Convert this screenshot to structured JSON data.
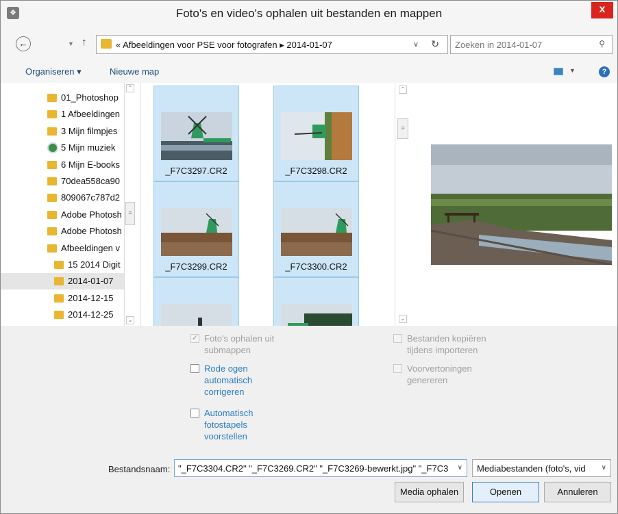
{
  "window": {
    "title": "Foto's en video's ophalen uit bestanden en mappen",
    "close_label": "x",
    "app_icon": "photoshop-elements-icon"
  },
  "address": {
    "path_prefix": "«",
    "path": "Afbeeldingen voor PSE voor fotografen  ▸  2014-01-07",
    "search_placeholder": "Zoeken in 2014-01-07"
  },
  "toolbar": {
    "organize": "Organiseren ▾",
    "new_folder": "Nieuwe map",
    "help": "?"
  },
  "nav": {
    "items": [
      {
        "label": "01_Photoshop",
        "icon": "folder-icon",
        "indent": false
      },
      {
        "label": "1 Afbeeldingen",
        "icon": "folder-icon",
        "indent": false
      },
      {
        "label": "3 Mijn filmpjes",
        "icon": "folder-icon",
        "indent": false
      },
      {
        "label": "5 Mijn muziek",
        "icon": "music-library-icon",
        "indent": false
      },
      {
        "label": "6 Mijn E-books",
        "icon": "folder-icon",
        "indent": false
      },
      {
        "label": "70dea558ca90",
        "icon": "folder-icon",
        "indent": false
      },
      {
        "label": "809067c787d2",
        "icon": "folder-icon",
        "indent": false
      },
      {
        "label": "Adobe Photosh",
        "icon": "folder-icon",
        "indent": false
      },
      {
        "label": "Adobe Photosh",
        "icon": "folder-icon",
        "indent": false
      },
      {
        "label": "Afbeeldingen v",
        "icon": "folder-icon",
        "indent": false
      },
      {
        "label": "15 2014 Digit",
        "icon": "folder-icon",
        "indent": true
      },
      {
        "label": "2014-01-07",
        "icon": "folder-icon",
        "indent": true,
        "selected": true
      },
      {
        "label": "2014-12-15",
        "icon": "folder-icon",
        "indent": true
      },
      {
        "label": "2014-12-25",
        "icon": "folder-icon",
        "indent": true
      }
    ]
  },
  "files": [
    {
      "name": "_F7C3297.CR2"
    },
    {
      "name": "_F7C3298.CR2"
    },
    {
      "name": "_F7C3299.CR2"
    },
    {
      "name": "_F7C3300.CR2"
    },
    {
      "name": ""
    },
    {
      "name": ""
    }
  ],
  "options": {
    "subfolders": {
      "label_1": "Foto's ophalen uit",
      "label_2": "submappen",
      "checked": true,
      "enabled": false
    },
    "red_eye": {
      "label_1": "Rode ogen",
      "label_2": "automatisch",
      "label_3": "corrigeren",
      "checked": false,
      "enabled": true
    },
    "stacks": {
      "label_1": "Automatisch",
      "label_2": "fotostapels",
      "label_3": "voorstellen",
      "checked": false,
      "enabled": true
    },
    "copy_files": {
      "label_1": "Bestanden kopiëren",
      "label_2": "tijdens importeren",
      "checked": false,
      "enabled": false
    },
    "previews": {
      "label_1": "Voorvertoningen",
      "label_2": "genereren",
      "checked": false,
      "enabled": false
    }
  },
  "footer": {
    "filename_label": "Bestandsnaam:",
    "filename_value": "\"_F7C3304.CR2\" \"_F7C3269.CR2\" \"_F7C3269-bewerkt.jpg\" \"_F7C3",
    "filter_value": "Mediabestanden (foto's, vid",
    "btn_media": "Media ophalen",
    "btn_open": "Openen",
    "btn_cancel": "Annuleren"
  },
  "colors": {
    "selection": "#cde6f7",
    "link": "#2b7cc0",
    "close": "#d9251d"
  }
}
